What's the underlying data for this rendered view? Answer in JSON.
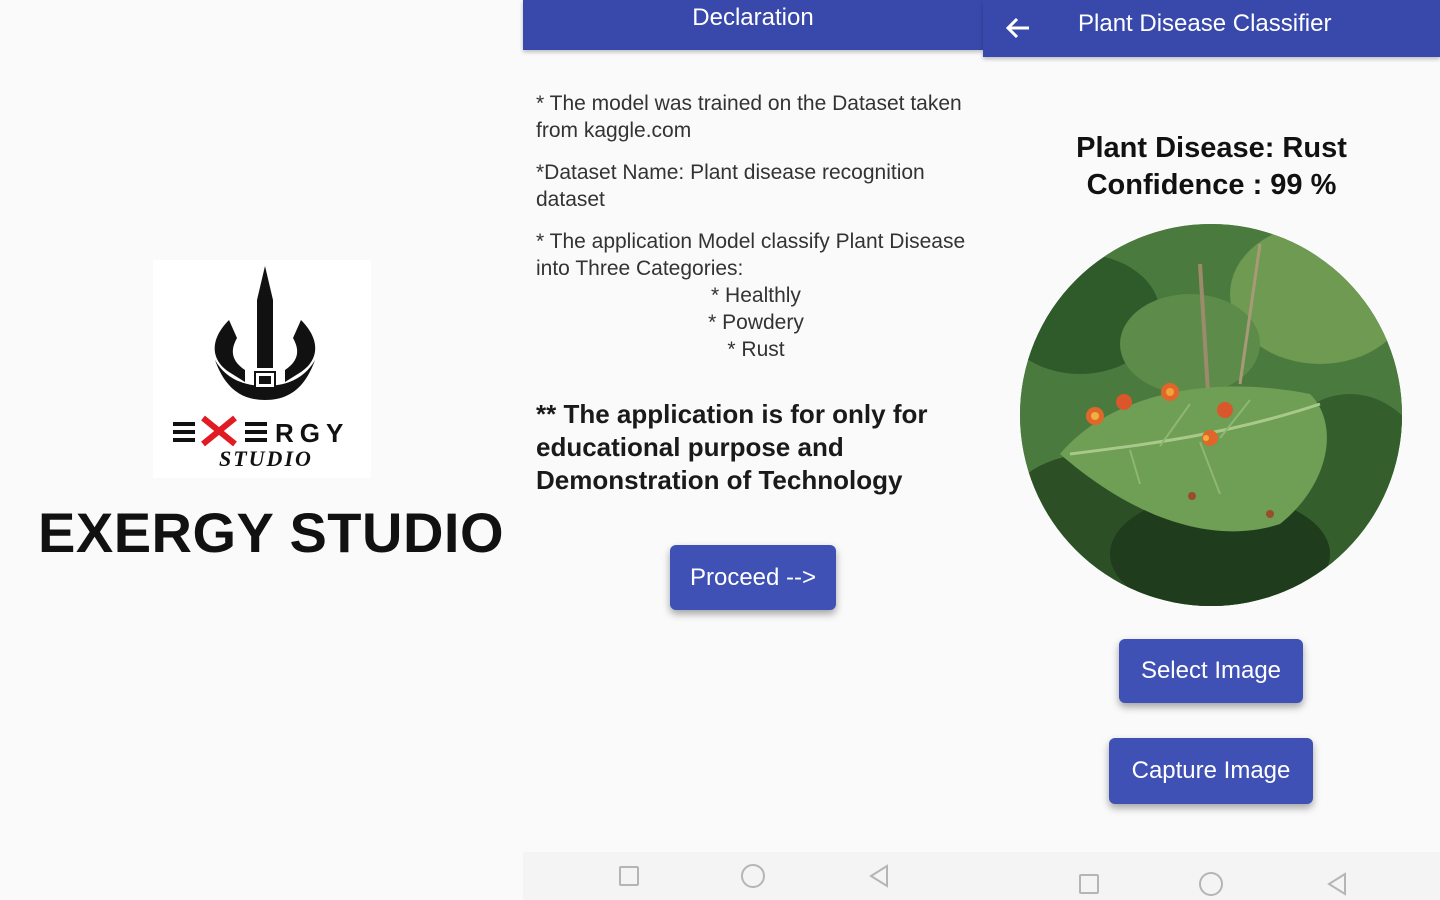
{
  "splash": {
    "logo_text": "EXERGY",
    "logo_sub": "STUDIO",
    "studio_name": "EXERGY STUDIO"
  },
  "declaration": {
    "title": "Declaration",
    "line1": " * The model was trained on the Dataset taken from kaggle.com",
    "line2": "*Dataset Name: Plant disease recognition dataset",
    "line3": "* The application Model classify Plant Disease into Three Categories:",
    "categories": [
      "* Healthly",
      "* Powdery",
      "* Rust"
    ],
    "disclaimer": "** The application is for only for educational purpose and Demonstration of Technology",
    "proceed_label": "Proceed -->"
  },
  "classifier": {
    "title": "Plant Disease Classifier",
    "result_line1": "Plant Disease: Rust",
    "result_line2": "Confidence : 99 %",
    "select_label": "Select Image",
    "capture_label": "Capture Image"
  },
  "colors": {
    "appbar": "#3949ab",
    "button": "#3f51b5",
    "background": "#fafafa"
  },
  "icons": [
    "trident-logo-icon",
    "back-arrow-icon",
    "nav-recents-icon",
    "nav-home-icon",
    "nav-back-icon"
  ]
}
